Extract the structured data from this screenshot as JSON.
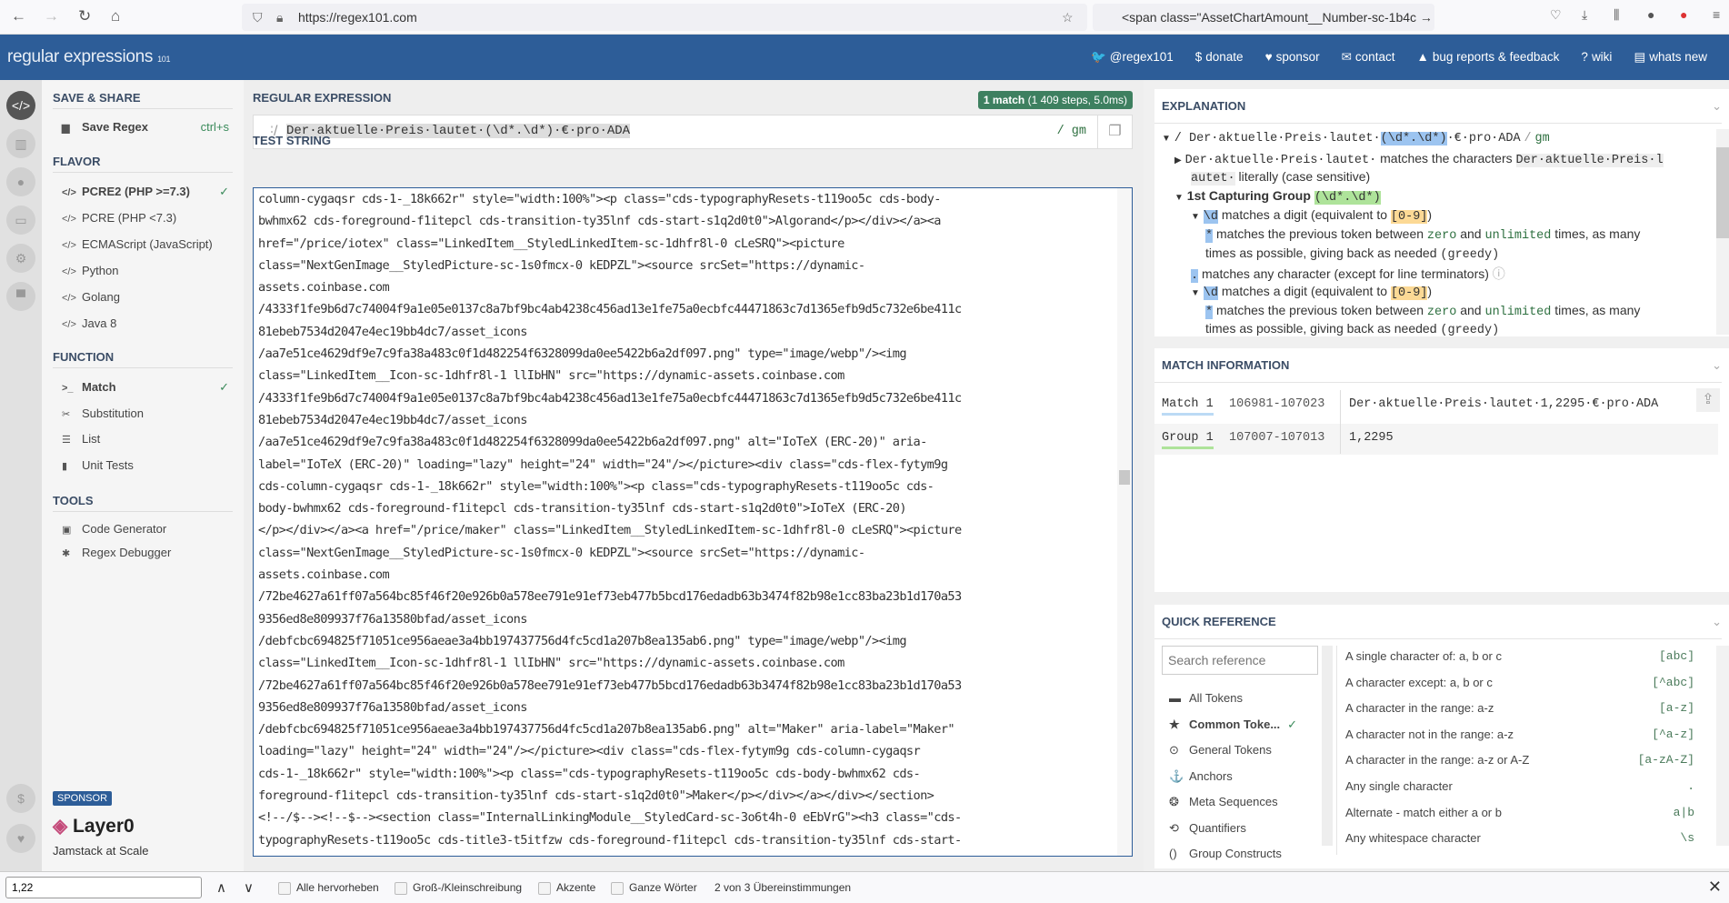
{
  "browser": {
    "url": "https://regex101.com",
    "search": "<span class=\"AssetChartAmount__Number-sc-1b4c →"
  },
  "header": {
    "logo": "regular expressions",
    "logo_sub": "101",
    "links": [
      {
        "icon": "twitter-icon",
        "glyph": "🐦",
        "label": "@regex101"
      },
      {
        "icon": "dollar-icon",
        "glyph": "$",
        "label": "donate"
      },
      {
        "icon": "heart-icon",
        "glyph": "♥",
        "label": "sponsor"
      },
      {
        "icon": "mail-icon",
        "glyph": "✉",
        "label": "contact"
      },
      {
        "icon": "warning-icon",
        "glyph": "▲",
        "label": "bug reports & feedback"
      },
      {
        "icon": "wiki-icon",
        "glyph": "?",
        "label": "wiki"
      },
      {
        "icon": "news-icon",
        "glyph": "▤",
        "label": "whats new"
      }
    ]
  },
  "sidebar": {
    "save_title": "SAVE & SHARE",
    "save_label": "Save Regex",
    "save_shortcut": "ctrl+s",
    "flavor_title": "FLAVOR",
    "flavors": [
      "PCRE2 (PHP >=7.3)",
      "PCRE (PHP <7.3)",
      "ECMAScript (JavaScript)",
      "Python",
      "Golang",
      "Java 8"
    ],
    "function_title": "FUNCTION",
    "functions": [
      "Match",
      "Substitution",
      "List",
      "Unit Tests"
    ],
    "tools_title": "TOOLS",
    "tools": [
      "Code Generator",
      "Regex Debugger"
    ],
    "sponsor_badge": "SPONSOR",
    "sponsor_name": "Layer0",
    "sponsor_tagline": "Jamstack at Scale"
  },
  "regex": {
    "title": "REGULAR EXPRESSION",
    "match_info": "1 match",
    "match_detail": "(1 409 steps, 5.0ms)",
    "delimiter": "/",
    "value": "Der·aktuelle·Preis·lautet·(\\d*.\\d*)·€·pro·ADA",
    "flags": "/ gm"
  },
  "test_string": {
    "title": "TEST STRING",
    "lines": [
      "column-cygaqsr cds-1-_18k662r\" style=\"width:100%\"><p class=\"cds-typographyResets-t119oo5c cds-body-",
      "bwhmx62 cds-foreground-f1itepcl cds-transition-ty35lnf cds-start-s1q2d0t0\">Algorand</p></div></a><a",
      "href=\"/price/iotex\" class=\"LinkedItem__StyledLinkedItem-sc-1dhfr8l-0 cLeSRQ\"><picture",
      "class=\"NextGenImage__StyledPicture-sc-1s0fmcx-0 kEDPZL\"><source srcSet=\"https://dynamic-",
      "assets.coinbase.com",
      "/4333f1fe9b6d7c74004f9a1e05e0137c8a7bf9bc4ab4238c456ad13e1fe75a0ecbfc44471863c7d1365efb9d5c732e6be411c",
      "81ebeb7534d2047e4ec19bb4dc7/asset_icons",
      "/aa7e51ce4629df9e7c9fa38a483c0f1d482254f6328099da0ee5422b6a2df097.png\" type=\"image/webp\"/><img",
      "class=\"LinkedItem__Icon-sc-1dhfr8l-1 llIbHN\" src=\"https://dynamic-assets.coinbase.com",
      "/4333f1fe9b6d7c74004f9a1e05e0137c8a7bf9bc4ab4238c456ad13e1fe75a0ecbfc44471863c7d1365efb9d5c732e6be411c",
      "81ebeb7534d2047e4ec19bb4dc7/asset_icons",
      "/aa7e51ce4629df9e7c9fa38a483c0f1d482254f6328099da0ee5422b6a2df097.png\" alt=\"IoTeX (ERC-20)\" aria-",
      "label=\"IoTeX (ERC-20)\" loading=\"lazy\" height=\"24\" width=\"24\"/></picture><div class=\"cds-flex-fytym9g",
      "cds-column-cygaqsr cds-1-_18k662r\" style=\"width:100%\"><p class=\"cds-typographyResets-t119oo5c cds-",
      "body-bwhmx62 cds-foreground-f1itepcl cds-transition-ty35lnf cds-start-s1q2d0t0\">IoTeX (ERC-20)",
      "</p></div></a><a href=\"/price/maker\" class=\"LinkedItem__StyledLinkedItem-sc-1dhfr8l-0 cLeSRQ\"><picture",
      "class=\"NextGenImage__StyledPicture-sc-1s0fmcx-0 kEDPZL\"><source srcSet=\"https://dynamic-",
      "assets.coinbase.com",
      "/72be4627a61ff07a564bc85f46f20e926b0a578ee791e91ef73eb477b5bcd176edadb63b3474f82b98e1cc83ba23b1d170a53",
      "9356ed8e809937f76a13580bfad/asset_icons",
      "/debfcbc694825f71051ce956aeae3a4bb197437756d4fc5cd1a207b8ea135ab6.png\" type=\"image/webp\"/><img",
      "class=\"LinkedItem__Icon-sc-1dhfr8l-1 llIbHN\" src=\"https://dynamic-assets.coinbase.com",
      "/72be4627a61ff07a564bc85f46f20e926b0a578ee791e91ef73eb477b5bcd176edadb63b3474f82b98e1cc83ba23b1d170a53",
      "9356ed8e809937f76a13580bfad/asset_icons",
      "/debfcbc694825f71051ce956aeae3a4bb197437756d4fc5cd1a207b8ea135ab6.png\" alt=\"Maker\" aria-label=\"Maker\"",
      "loading=\"lazy\" height=\"24\" width=\"24\"/></picture><div class=\"cds-flex-fytym9g cds-column-cygaqsr",
      "cds-1-_18k662r\" style=\"width:100%\"><p class=\"cds-typographyResets-t119oo5c cds-body-bwhmx62 cds-",
      "foreground-f1itepcl cds-transition-ty35lnf cds-start-s1q2d0t0\">Maker</p></div></a></div></section>",
      "<!--/$--><!--$--><section class=\"InternalLinkingModule__StyledCard-sc-3o6t4h-0 eEbVrG\"><h3 class=\"cds-",
      "typographyResets-t119oo5c cds-title3-t5itfzw cds-foreground-f1itepcl cds-transition-ty35lnf cds-start-"
    ]
  },
  "explanation": {
    "title": "EXPLANATION",
    "l1_pre": "/ Der·aktuelle·Preis·lautet·",
    "l1_group": "(\\d*.\\d*)",
    "l1_post": "·€·pro·ADA",
    "l1_delim": "/",
    "l1_flags": "gm",
    "l2_token": "Der·aktuelle·Preis·lautet·",
    "l2_text": "matches the characters",
    "l2_lit1": "Der·aktuelle·Preis·l",
    "l2_lit2": "autet·",
    "l2_tail": "literally (case sensitive)",
    "g_title": "1st Capturing Group",
    "g_token": "(\\d*.\\d*)",
    "d_token": "\\d",
    "d_text": "matches a digit (equivalent to",
    "d_range": "[0-9]",
    "close": ")",
    "s_token": "*",
    "s_text1": "matches the previous token between",
    "zero": "zero",
    "and": "and",
    "unlimited": "unlimited",
    "s_text2": "times, as many",
    "s_text3": "times as possible, giving back as needed",
    "greedy": "(greedy)",
    "dot_token": ".",
    "dot_text": "matches any character (except for line terminators)"
  },
  "match_information": {
    "title": "MATCH INFORMATION",
    "rows": [
      {
        "label": "Match 1",
        "range": "106981-107023",
        "value": "Der·aktuelle·Preis·lautet·1,2295·€·pro·ADA",
        "color": "#bcdaf5"
      },
      {
        "label": "Group 1",
        "range": "107007-107013",
        "value": "1,2295",
        "color": "#aee39a"
      }
    ]
  },
  "quick_reference": {
    "title": "QUICK REFERENCE",
    "search_placeholder": "Search reference",
    "categories": [
      {
        "label": "All Tokens",
        "glyph": "▬"
      },
      {
        "label": "Common Toke...",
        "glyph": "★",
        "selected": true
      },
      {
        "label": "General Tokens",
        "glyph": "⊙"
      },
      {
        "label": "Anchors",
        "glyph": "⚓"
      },
      {
        "label": "Meta Sequences",
        "glyph": "❂"
      },
      {
        "label": "Quantifiers",
        "glyph": "⟲"
      },
      {
        "label": "Group Constructs",
        "glyph": "()"
      }
    ],
    "items": [
      {
        "desc": "A single character of: a, b or c",
        "code": "[abc]"
      },
      {
        "desc": "A character except: a, b or c",
        "code": "[^abc]"
      },
      {
        "desc": "A character in the range: a-z",
        "code": "[a-z]"
      },
      {
        "desc": "A character not in the range: a-z",
        "code": "[^a-z]"
      },
      {
        "desc": "A character in the range: a-z or A-Z",
        "code": "[a-zA-Z]"
      },
      {
        "desc": "Any single character",
        "code": "."
      },
      {
        "desc": "Alternate - match either a or b",
        "code": "a|b"
      },
      {
        "desc": "Any whitespace character",
        "code": "\\s"
      }
    ]
  },
  "findbar": {
    "value": "1,22",
    "highlight_all": "Alle hervorheben",
    "match_case": "Groß-/Kleinschreibung",
    "accents": "Akzente",
    "whole_words": "Ganze Wörter",
    "status": "2 von 3 Übereinstimmungen"
  }
}
